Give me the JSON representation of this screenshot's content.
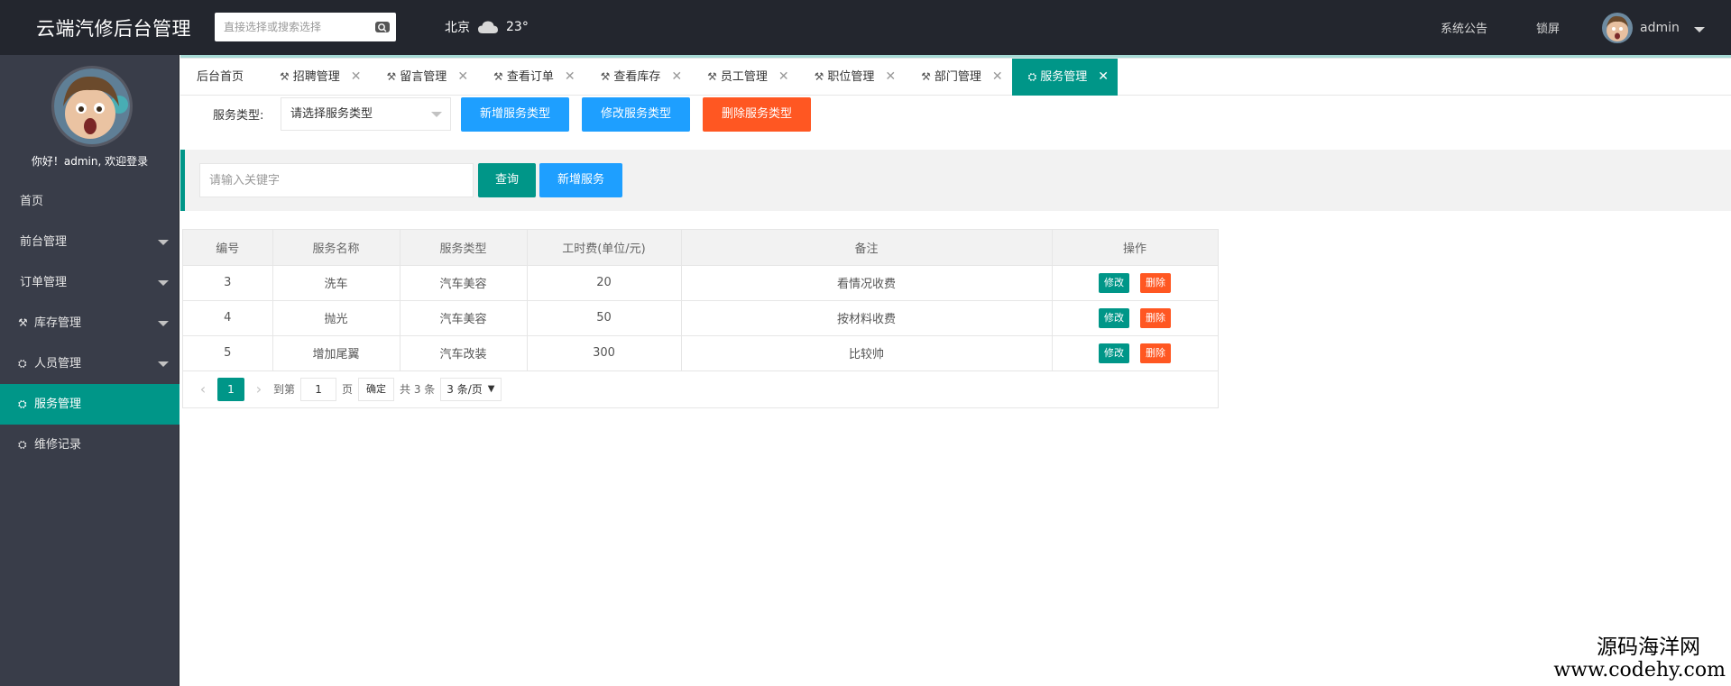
{
  "header": {
    "app_title": "云端汽修后台管理",
    "search_placeholder": "直接选择或搜索选择",
    "weather_city": "北京",
    "weather_temp": "23°",
    "notice": "系统公告",
    "lock": "锁屏",
    "username": "admin"
  },
  "sidebar": {
    "greeting": "你好！admin, 欢迎登录",
    "items": [
      {
        "label": "首页",
        "icon": "",
        "has_arrow": false
      },
      {
        "label": "前台管理",
        "icon": "",
        "has_arrow": true
      },
      {
        "label": "订单管理",
        "icon": "",
        "has_arrow": true
      },
      {
        "label": "库存管理",
        "icon": "tools-icon",
        "has_arrow": true
      },
      {
        "label": "人员管理",
        "icon": "users-icon",
        "has_arrow": true
      },
      {
        "label": "服务管理",
        "icon": "users-icon",
        "has_arrow": false,
        "active": true
      },
      {
        "label": "维修记录",
        "icon": "users-icon",
        "has_arrow": false
      }
    ]
  },
  "tabs": [
    {
      "label": "后台首页",
      "icon": "",
      "closable": false
    },
    {
      "label": "招聘管理",
      "icon": "tools-icon",
      "closable": true
    },
    {
      "label": "留言管理",
      "icon": "tools-icon",
      "closable": true
    },
    {
      "label": "查看订单",
      "icon": "tools-icon",
      "closable": true
    },
    {
      "label": "查看库存",
      "icon": "tools-icon",
      "closable": true
    },
    {
      "label": "员工管理",
      "icon": "tools-icon",
      "closable": true
    },
    {
      "label": "职位管理",
      "icon": "tools-icon",
      "closable": true
    },
    {
      "label": "部门管理",
      "icon": "tools-icon",
      "closable": true
    },
    {
      "label": "服务管理",
      "icon": "users-icon",
      "closable": true,
      "active": true
    }
  ],
  "type_row": {
    "label": "服务类型:",
    "select_value": "请选择服务类型",
    "add_type": "新增服务类型",
    "edit_type": "修改服务类型",
    "delete_type": "删除服务类型"
  },
  "search": {
    "placeholder": "请输入关键字",
    "query": "查询",
    "add_service": "新增服务"
  },
  "table": {
    "headers": [
      "编号",
      "服务名称",
      "服务类型",
      "工时费(单位/元)",
      "备注",
      "操作"
    ],
    "rows": [
      {
        "id": "3",
        "name": "洗车",
        "type": "汽车美容",
        "fee": "20",
        "note": "看情况收费"
      },
      {
        "id": "4",
        "name": "抛光",
        "type": "汽车美容",
        "fee": "50",
        "note": "按材料收费"
      },
      {
        "id": "5",
        "name": "增加尾翼",
        "type": "汽车改装",
        "fee": "300",
        "note": "比较帅"
      }
    ],
    "edit_label": "修改",
    "delete_label": "删除"
  },
  "pager": {
    "current": "1",
    "goto_label": "到第",
    "goto_value": "1",
    "page_unit": "页",
    "confirm": "确定",
    "total": "共 3 条",
    "page_size": "3 条/页"
  },
  "watermark": {
    "line1": "源码海洋网",
    "line2": "www.codehy.com"
  },
  "colors": {
    "accent": "#009688",
    "blue": "#1e9fff",
    "orange": "#ff5722",
    "header_bg": "#23262e",
    "sidebar_bg": "#393d49"
  }
}
